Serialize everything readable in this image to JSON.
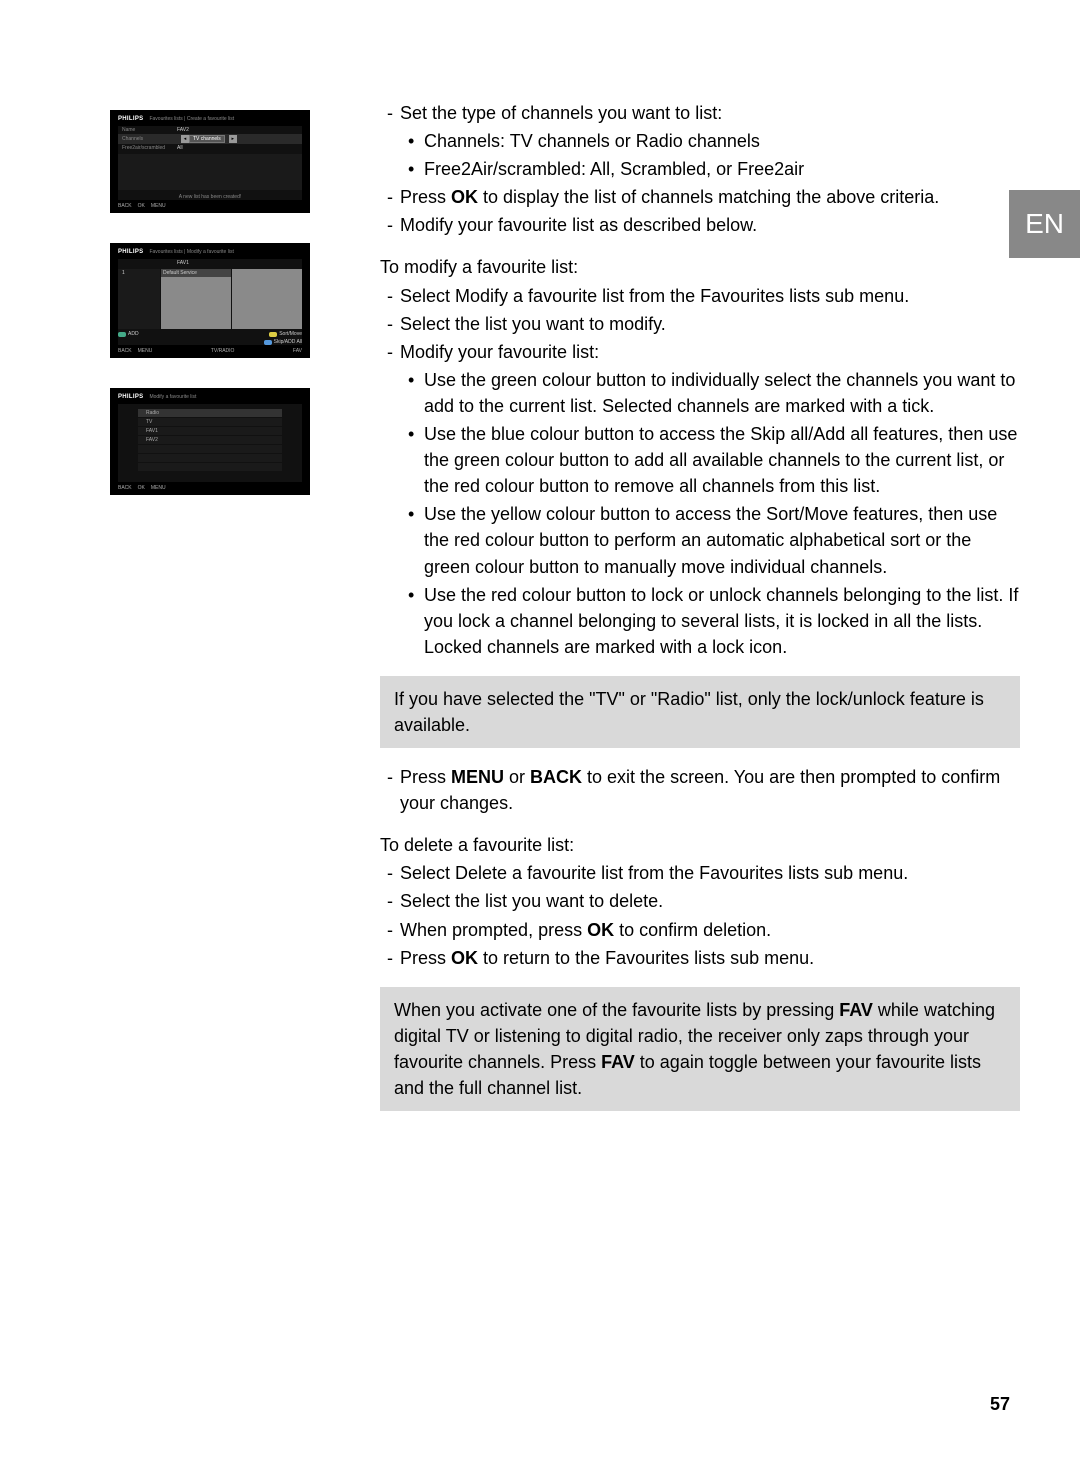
{
  "lang_tab": "EN",
  "page_number": "57",
  "scr1": {
    "brand": "PHILIPS",
    "crumb": "Favourites lists | Create a favourite list",
    "rows": {
      "name_lbl": "Name",
      "name_val": "FAV2",
      "ch_lbl": "Channels",
      "ch_val": "TV channels",
      "fs_lbl": "Free2air/scrambled",
      "fs_val": "All"
    },
    "notice": "A new list has been created!",
    "footer": {
      "back": "BACK",
      "ok": "OK",
      "menu": "MENU"
    }
  },
  "scr2": {
    "brand": "PHILIPS",
    "crumb": "Favourites lists | Modify a favourite list",
    "title": "FAV1",
    "num": "1",
    "item": "Default Service",
    "legend": {
      "add": "ADD",
      "sort": "Sort/Move",
      "skip": "Skip/ADD All"
    },
    "footer": {
      "back": "BACK",
      "menu": "MENU",
      "tv": "TV/RADIO",
      "fav": "FAV"
    }
  },
  "scr3": {
    "brand": "PHILIPS",
    "crumb": "Modify a favourite list",
    "items": [
      "Radio",
      "TV",
      "FAV1",
      "FAV2"
    ],
    "footer": {
      "back": "BACK",
      "ok": "OK",
      "menu": "MENU"
    }
  },
  "body": {
    "p1": "Set the type of channels you want to list:",
    "p1b1": "Channels: TV channels or Radio channels",
    "p1b2": "Free2Air/scrambled: All, Scrambled, or Free2air",
    "p2a": "Press ",
    "p2b": "OK",
    "p2c": " to display the list of channels matching the above criteria.",
    "p3": "Modify your favourite list as described below.",
    "h1": "To modify a favourite list:",
    "p4": "Select Modify a favourite list from the Favourites lists sub menu.",
    "p5": "Select the list you want to modify.",
    "p6": "Modify your favourite list:",
    "p6b1": "Use the green colour button to individually select the channels you want to add to the current list. Selected channels are marked with a tick.",
    "p6b2": "Use the blue colour button to access the Skip all/Add all features, then use the green colour button to add all available channels to the current list, or the red colour button to remove all channels from this list.",
    "p6b3": "Use the yellow colour button to access the Sort/Move features, then use the red colour button to perform an automatic alphabetical sort or the green colour button to manually move individual channels.",
    "p6b4": "Use the red colour button to lock or unlock channels belonging to the list. If you lock a channel belonging to several lists, it is locked in all the lists. Locked channels are marked with a lock icon.",
    "box1": "If you have selected the \"TV\" or \"Radio\" list, only the lock/unlock feature is available.",
    "p7a": "Press ",
    "p7b": "MENU",
    "p7c": " or ",
    "p7d": "BACK",
    "p7e": " to exit the screen. You are then prompted to confirm your changes.",
    "h2": "To delete a favourite list:",
    "p8": "Select Delete a favourite list from the Favourites lists sub menu.",
    "p9": "Select the list you want to delete.",
    "p10a": "When prompted, press ",
    "p10b": "OK",
    "p10c": " to confirm deletion.",
    "p11a": "Press ",
    "p11b": "OK",
    "p11c": " to return to the Favourites lists sub menu.",
    "box2a": "When you activate one of the favourite lists by pressing ",
    "box2b": "FAV",
    "box2c": " while watching digital TV or listening to digital radio, the receiver only zaps through your favourite channels. Press ",
    "box2d": "FAV",
    "box2e": " to again toggle between your favourite lists and the full channel list."
  }
}
